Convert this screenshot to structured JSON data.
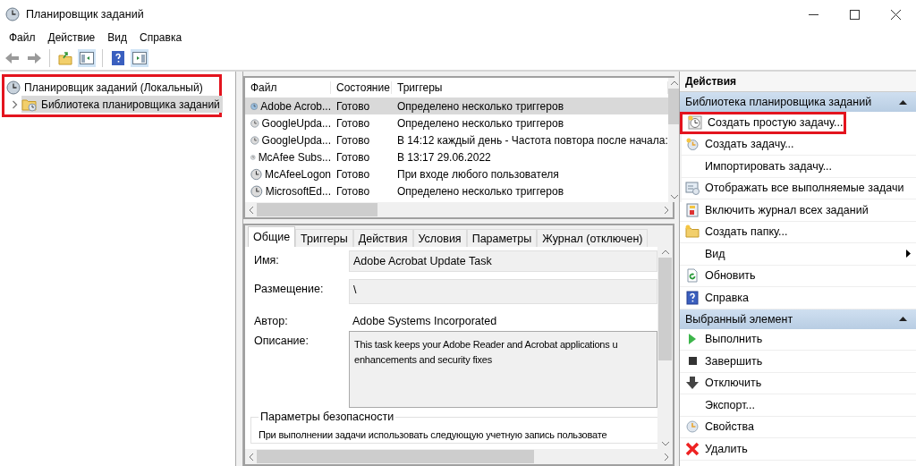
{
  "window": {
    "title": "Планировщик заданий"
  },
  "menu": [
    "Файл",
    "Действие",
    "Вид",
    "Справка"
  ],
  "tree": {
    "highlighted": true,
    "root": {
      "label": "Планировщик заданий (Локальный)",
      "children": [
        {
          "label": "Библиотека планировщика заданий",
          "selected": true
        }
      ]
    }
  },
  "tasks": {
    "columns": [
      "Файл",
      "Состояние",
      "Триггеры"
    ],
    "rows": [
      {
        "name": "Adobe Acrob...",
        "status": "Готово",
        "triggers": "Определено несколько триггеров",
        "selected": true
      },
      {
        "name": "GoogleUpda...",
        "status": "Готово",
        "triggers": "Определено несколько триггеров",
        "selected": false
      },
      {
        "name": "GoogleUpda...",
        "status": "Готово",
        "triggers": "В 14:12 каждый день - Частота повтора после начала:",
        "selected": false
      },
      {
        "name": "McAfee Subs...",
        "status": "Готово",
        "triggers": "В 13:17 29.06.2022",
        "selected": false
      },
      {
        "name": "McAfeeLogon",
        "status": "Готово",
        "triggers": "При входе любого пользователя",
        "selected": false
      },
      {
        "name": "MicrosoftEd...",
        "status": "Готово",
        "triggers": "Определено несколько триггеров",
        "selected": false
      }
    ]
  },
  "details": {
    "tabs": [
      {
        "label": "Общие",
        "selected": true
      },
      {
        "label": "Триггеры",
        "selected": false
      },
      {
        "label": "Действия",
        "selected": false
      },
      {
        "label": "Условия",
        "selected": false
      },
      {
        "label": "Параметры",
        "selected": false
      },
      {
        "label": "Журнал (отключен)",
        "selected": false
      }
    ],
    "name_label": "Имя:",
    "name_value": "Adobe Acrobat Update Task",
    "location_label": "Размещение:",
    "location_value": "\\",
    "author_label": "Автор:",
    "author_value": "Adobe Systems Incorporated",
    "description_label": "Описание:",
    "description_lines": [
      "This task keeps your Adobe Reader and Acrobat applications u",
      "enhancements and security fixes"
    ],
    "security_title": "Параметры безопасности",
    "security_text": "При выполнении задачи использовать следующую учетную запись пользовате"
  },
  "actions": {
    "title": "Действия",
    "sections": [
      {
        "title": "Библиотека планировщика заданий",
        "expanded": true,
        "items": [
          {
            "label": "Создать простую задачу...",
            "highlighted": true,
            "submenu": false
          },
          {
            "label": "Создать задачу...",
            "highlighted": false,
            "submenu": false
          },
          {
            "label": "Импортировать задачу...",
            "highlighted": false,
            "submenu": false
          },
          {
            "label": "Отображать все выполняемые задачи",
            "highlighted": false,
            "submenu": false
          },
          {
            "label": "Включить журнал всех заданий",
            "highlighted": false,
            "submenu": false
          },
          {
            "label": "Создать папку...",
            "highlighted": false,
            "submenu": false
          },
          {
            "label": "Вид",
            "highlighted": false,
            "submenu": true
          },
          {
            "label": "Обновить",
            "highlighted": false,
            "submenu": false
          },
          {
            "label": "Справка",
            "highlighted": false,
            "submenu": false
          }
        ]
      },
      {
        "title": "Выбранный элемент",
        "expanded": true,
        "items": [
          {
            "label": "Выполнить",
            "highlighted": false,
            "submenu": false
          },
          {
            "label": "Завершить",
            "highlighted": false,
            "submenu": false
          },
          {
            "label": "Отключить",
            "highlighted": false,
            "submenu": false
          },
          {
            "label": "Экспорт...",
            "highlighted": false,
            "submenu": false
          },
          {
            "label": "Свойства",
            "highlighted": false,
            "submenu": false
          },
          {
            "label": "Удалить",
            "highlighted": false,
            "submenu": false
          }
        ]
      }
    ]
  }
}
